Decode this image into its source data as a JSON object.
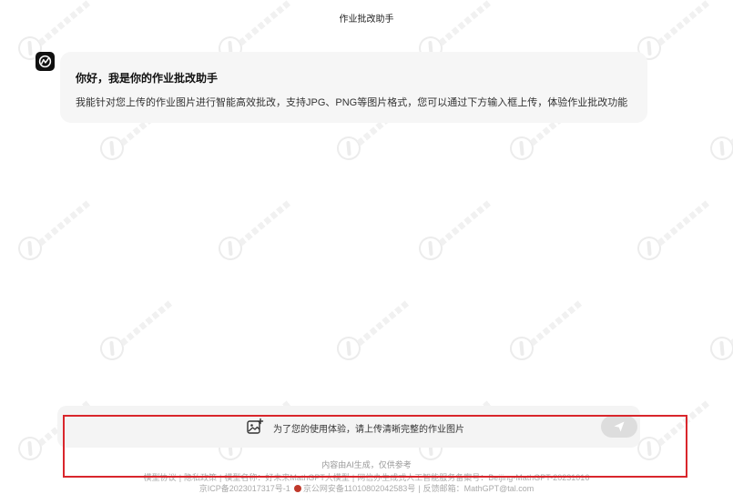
{
  "page": {
    "title": "作业批改助手"
  },
  "chat": {
    "bot_avatar_icon": "chart-logo-icon",
    "greeting_title": "你好，我是你的作业批改助手",
    "greeting_body": "我能针对您上传的作业图片进行智能高效批改，支持JPG、PNG等图片格式，您可以通过下方输入框上传，体验作业批改功能"
  },
  "input": {
    "upload_icon": "image-upload-icon",
    "placeholder": "为了您的使用体验，请上传清晰完整的作业图片",
    "send_icon": "send-icon"
  },
  "footer": {
    "disclaimer": "内容由AI生成，仅供参考",
    "links": {
      "model_agreement": "模型协议",
      "privacy_policy": "隐私政策",
      "model_name": "模型名称：好未来MathGPT大模型",
      "filing": "网信办生成式人工智能服务备案号：Beijing-MathGPT-20231016",
      "icp": "京ICP备2023017317号-1",
      "police": "京公网安备11010802042583号",
      "report_email": "反馈邮箱：MathGPT@tal.com"
    },
    "separator": "|"
  },
  "colors": {
    "highlight": "#d9262c",
    "bubble_bg": "#f6f6f6",
    "input_bg": "#f4f4f4",
    "send_bg": "#dddddd"
  }
}
